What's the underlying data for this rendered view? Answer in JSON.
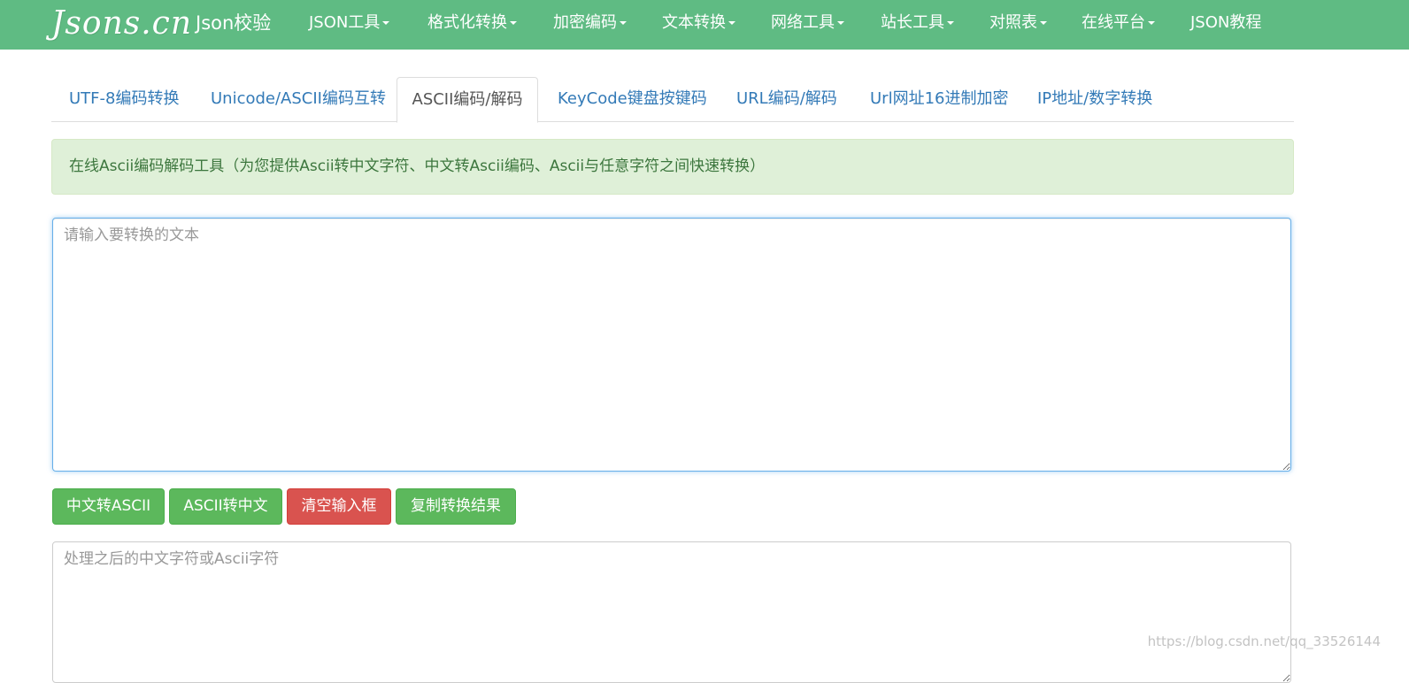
{
  "navbar": {
    "logo": "Jsons.cn",
    "brand": "Json校验",
    "items": [
      {
        "label": "JSON工具",
        "dropdown": true
      },
      {
        "label": "格式化转换",
        "dropdown": true
      },
      {
        "label": "加密编码",
        "dropdown": true
      },
      {
        "label": "文本转换",
        "dropdown": true
      },
      {
        "label": "网络工具",
        "dropdown": true
      },
      {
        "label": "站长工具",
        "dropdown": true
      },
      {
        "label": "对照表",
        "dropdown": true
      },
      {
        "label": "在线平台",
        "dropdown": true
      },
      {
        "label": "JSON教程",
        "dropdown": false
      }
    ],
    "bg_color": "#5fbb83"
  },
  "tabs": [
    {
      "label": "UTF-8编码转换",
      "active": false
    },
    {
      "label": "Unicode/ASCII编码互转",
      "active": false
    },
    {
      "label": "ASCII编码/解码",
      "active": true
    },
    {
      "label": "KeyCode键盘按键码",
      "active": false
    },
    {
      "label": "URL编码/解码",
      "active": false
    },
    {
      "label": "Url网址16进制加密",
      "active": false
    },
    {
      "label": "IP地址/数字转换",
      "active": false
    }
  ],
  "alert": {
    "text": "在线Ascii编码解码工具（为您提供Ascii转中文字符、中文转Ascii编码、Ascii与任意字符之间快速转换）"
  },
  "input": {
    "placeholder": "请输入要转换的文本",
    "value": ""
  },
  "buttons": {
    "to_ascii": "中文转ASCII",
    "to_chinese": "ASCII转中文",
    "clear": "清空输入框",
    "copy": "复制转换结果"
  },
  "output": {
    "placeholder": "处理之后的中文字符或Ascii字符",
    "value": ""
  },
  "watermark": "https://blog.csdn.net/qq_33526144",
  "colors": {
    "success": "#5cb85c",
    "danger": "#d9534f",
    "link": "#337ab7",
    "alert_bg": "#dff0d8"
  }
}
